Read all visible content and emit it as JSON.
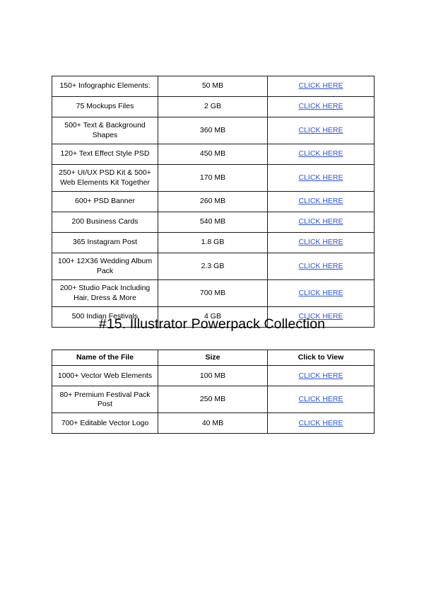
{
  "document": {
    "background_color": "#ffffff",
    "text_color": "#000000",
    "link_color": "#2b56d8",
    "border_color": "#1a1a1a"
  },
  "table_one": {
    "name": "asset-list-table-continued",
    "has_header": false,
    "rows": [
      {
        "file_name": "150+ Infographic Elements:",
        "size": "50 MB",
        "link_label": "CLICK HERE",
        "multiline": false
      },
      {
        "file_name": "75 Mockups Files",
        "size": "2 GB",
        "link_label": "CLICK HERE",
        "multiline": false
      },
      {
        "file_name": "500+ Text & Background Shapes",
        "size": "360 MB",
        "link_label": "CLICK HERE",
        "multiline": true
      },
      {
        "file_name": "120+ Text Effect Style PSD",
        "size": "450 MB",
        "link_label": "CLICK HERE",
        "multiline": false
      },
      {
        "file_name": "250+ UI/UX PSD Kit & 500+ Web Elements Kit Together",
        "size": "170 MB",
        "link_label": "CLICK HERE",
        "multiline": true
      },
      {
        "file_name": "600+ PSD Banner",
        "size": "260 MB",
        "link_label": "CLICK HERE",
        "multiline": false
      },
      {
        "file_name": "200 Business Cards",
        "size": "540 MB",
        "link_label": "CLICK HERE",
        "multiline": false
      },
      {
        "file_name": "365 Instagram Post",
        "size": "1.8 GB",
        "link_label": "CLICK HERE",
        "multiline": false
      },
      {
        "file_name": "100+ 12X36 Wedding Album Pack",
        "size": "2.3 GB",
        "link_label": "CLICK HERE",
        "multiline": true
      },
      {
        "file_name": "200+ Studio Pack Including Hair, Dress & More",
        "size": "700 MB",
        "link_label": "CLICK HERE",
        "multiline": true
      },
      {
        "file_name": "500 Indian Festivals",
        "size": "4 GB",
        "link_label": "CLICK HERE",
        "multiline": false
      }
    ]
  },
  "heading": {
    "text": "#15. Illustrator Powerpack Collection"
  },
  "table_two": {
    "name": "illustrator-powerpack-table",
    "has_header": true,
    "headers": {
      "file_name": "Name of the File",
      "size": "Size",
      "link": "Click to View"
    },
    "rows": [
      {
        "file_name": "1000+ Vector Web Elements",
        "size": "100 MB",
        "link_label": "CLICK HERE",
        "multiline": false
      },
      {
        "file_name": "80+ Premium Festival Pack Post",
        "size": "250 MB",
        "link_label": "CLICK HERE",
        "multiline": true
      },
      {
        "file_name": "700+ Editable Vector Logo",
        "size": "40 MB",
        "link_label": "CLICK HERE",
        "multiline": false
      }
    ]
  }
}
